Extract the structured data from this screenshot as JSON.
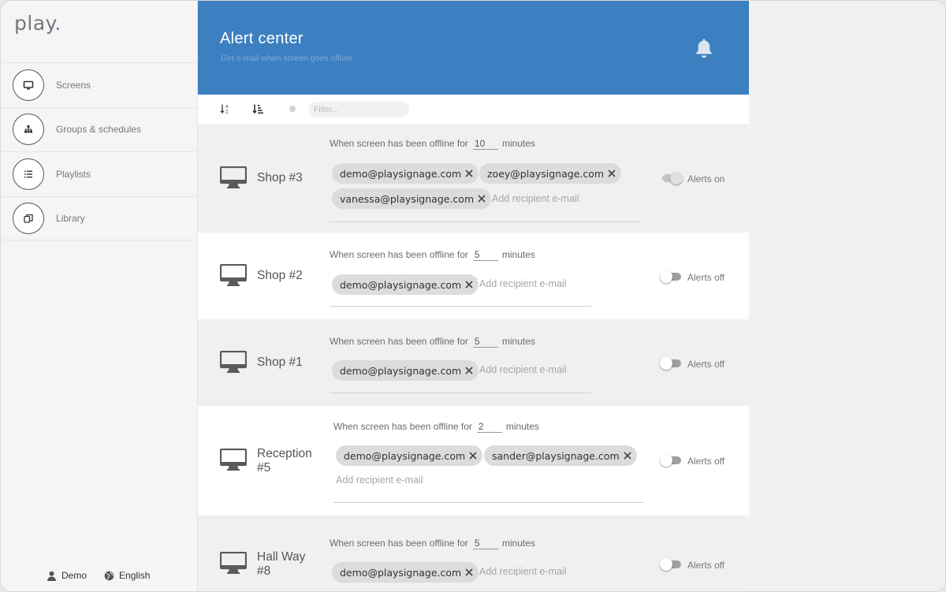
{
  "sidebar": {
    "logo": "play",
    "items": [
      {
        "label": "Screens",
        "icon": "monitor-icon"
      },
      {
        "label": "Groups & schedules",
        "icon": "groups-icon"
      },
      {
        "label": "Playlists",
        "icon": "playlist-icon"
      },
      {
        "label": "Library",
        "icon": "library-icon"
      }
    ],
    "footer": {
      "user": "Demo",
      "language": "English"
    }
  },
  "header": {
    "title": "Alert center",
    "subtitle": "Get e-mail when screen goes offline",
    "color": "#3d80c1"
  },
  "toolbar": {
    "filter_placeholder": "Filter..."
  },
  "common": {
    "offline_prefix": "When screen has been offline for",
    "offline_suffix": "minutes",
    "add_placeholder": "Add recipient e-mail"
  },
  "rows": [
    {
      "name": "Shop #3",
      "minutes": "10",
      "recipients": [
        "demo@playsignage.com",
        "zoey@playsignage.com",
        "vanessa@playsignage.com"
      ],
      "alerts": "Alerts on"
    },
    {
      "name": "Shop #2",
      "minutes": "5",
      "recipients": [
        "demo@playsignage.com"
      ],
      "alerts": "Alerts off"
    },
    {
      "name": "Shop #1",
      "minutes": "5",
      "recipients": [
        "demo@playsignage.com"
      ],
      "alerts": "Alerts off"
    },
    {
      "name": "Reception #5",
      "minutes": "2",
      "recipients": [
        "demo@playsignage.com",
        "sander@playsignage.com"
      ],
      "alerts": "Alerts off"
    },
    {
      "name": "Hall Way #8",
      "minutes": "5",
      "recipients": [
        "demo@playsignage.com"
      ],
      "alerts": "Alerts off"
    }
  ]
}
